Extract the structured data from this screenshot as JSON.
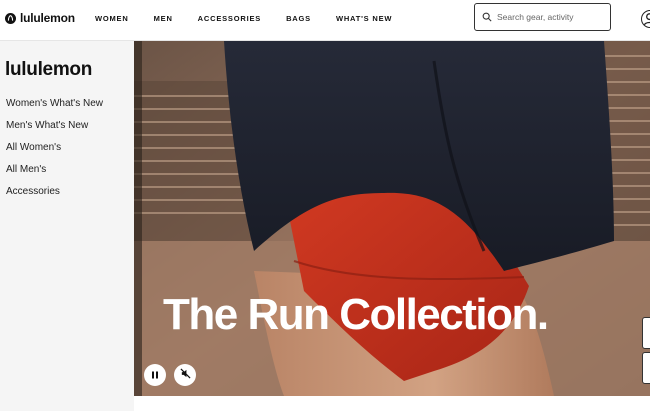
{
  "header": {
    "logo_text": "lululemon",
    "nav": [
      "WOMEN",
      "MEN",
      "ACCESSORIES",
      "BAGS",
      "WHAT'S NEW"
    ],
    "search_placeholder": "Search gear, activity"
  },
  "sidebar": {
    "title": "lululemon",
    "links": [
      "Women's What's New",
      "Men's What's New",
      "All Women's",
      "All Men's",
      "Accessories"
    ]
  },
  "hero": {
    "headline": "The Run Collection.",
    "controls": {
      "pause_icon": "pause-icon",
      "mute_icon": "mute-icon"
    }
  },
  "colors": {
    "text": "#111111",
    "sidebar_bg": "#f5f5f5",
    "shorts_red": "#c8321f",
    "jacket_navy": "#1f2230"
  }
}
